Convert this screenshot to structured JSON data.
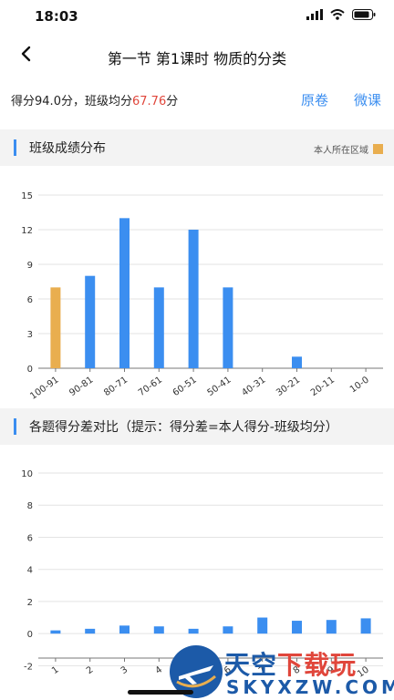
{
  "status_bar": {
    "time": "18:03",
    "icons": [
      "signal-icon",
      "wifi-icon",
      "battery-icon"
    ]
  },
  "nav": {
    "back_icon": "chevron-left-icon",
    "title": "第一节 第1课时 物质的分类"
  },
  "score": {
    "label": "得分",
    "value": "94.0分",
    "separator": "，",
    "avg_label": "班级均分",
    "avg_value": "67.76",
    "avg_unit": "分"
  },
  "actions": {
    "paper_label": "原卷",
    "video_label": "微课"
  },
  "section1": {
    "title": "班级成绩分布",
    "legend_label": "本人所在区域"
  },
  "section2": {
    "title": "各题得分差对比（提示：得分差=本人得分-班级均分）"
  },
  "colors": {
    "accent": "#3b8ef0",
    "highlight": "#e9ae4f",
    "score_red": "#e0463b"
  },
  "chart_data": [
    {
      "type": "bar",
      "categories": [
        "100-91",
        "90-81",
        "80-71",
        "70-61",
        "60-51",
        "50-41",
        "40-31",
        "30-21",
        "20-11",
        "10-0"
      ],
      "values": [
        7,
        8,
        13,
        7,
        12,
        7,
        0,
        1,
        0,
        0
      ],
      "highlight_category": "100-91",
      "yticks": [
        0,
        3,
        6,
        9,
        12,
        15
      ],
      "ylim": [
        0,
        15
      ],
      "grid": true
    },
    {
      "type": "bar",
      "categories": [
        "1",
        "2",
        "3",
        "4",
        "5",
        "6",
        "7",
        "8",
        "9",
        "10"
      ],
      "values": [
        0.2,
        0.3,
        0.5,
        0.45,
        0.3,
        0.45,
        1.0,
        0.8,
        0.85,
        0.95
      ],
      "yticks": [
        -2,
        0,
        2,
        4,
        6,
        8,
        10
      ],
      "ylim": [
        -3,
        10
      ],
      "grid": true
    }
  ],
  "watermark": {
    "top_blue": "天空",
    "top_red": "下载玩",
    "bottom": "SKYXZW.COM"
  }
}
